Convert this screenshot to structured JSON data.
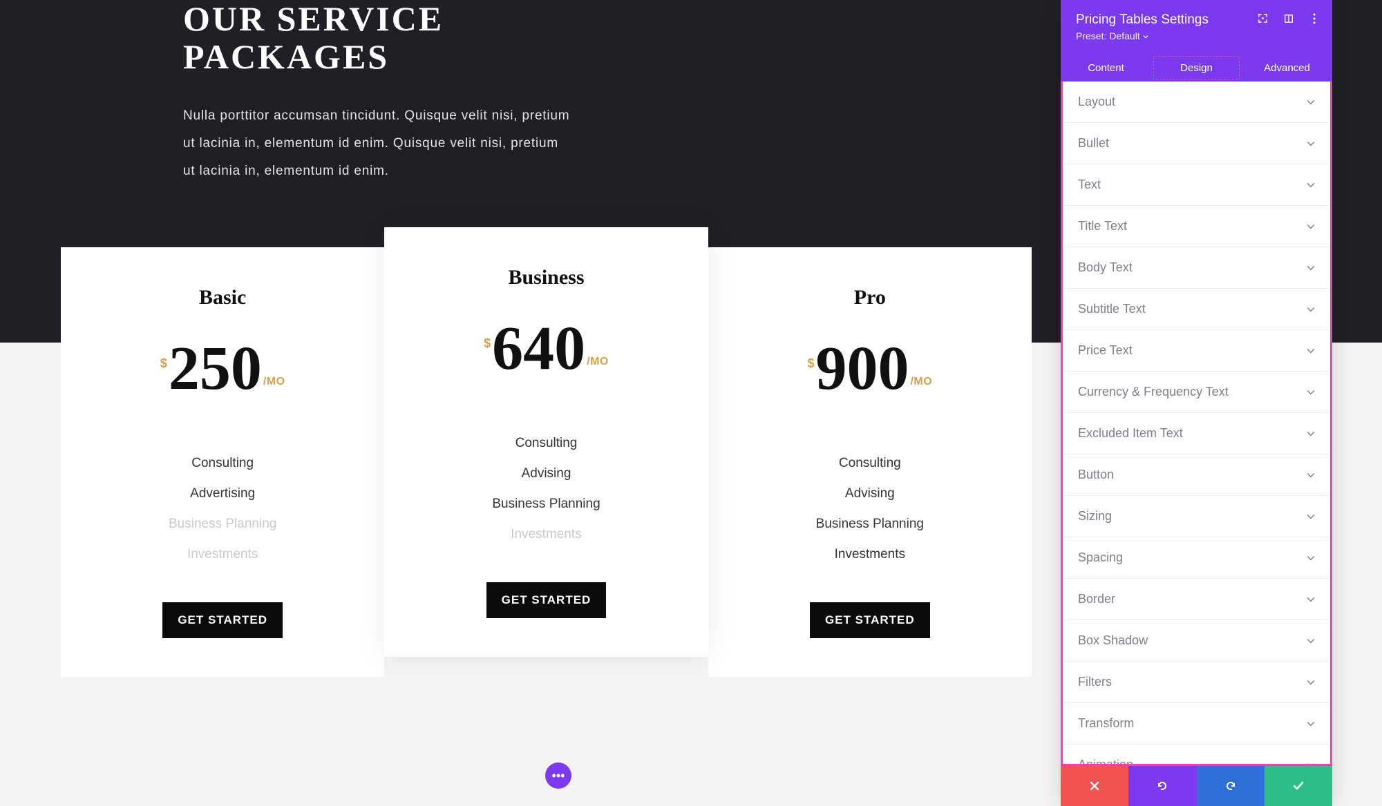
{
  "hero": {
    "title_line1": "OUR SERVICE",
    "title_line2": "PACKAGES",
    "body": "Nulla porttitor accumsan tincidunt. Quisque velit nisi, pretium ut lacinia in, elementum id enim. Quisque velit nisi, pretium ut lacinia in, elementum id enim."
  },
  "pricing": {
    "currency": "$",
    "frequency": "/MO",
    "cta_label": "GET STARTED",
    "tiers": [
      {
        "name": "Basic",
        "price": "250",
        "features": [
          {
            "label": "Consulting",
            "excluded": false
          },
          {
            "label": "Advertising",
            "excluded": false
          },
          {
            "label": "Business Planning",
            "excluded": true
          },
          {
            "label": "Investments",
            "excluded": true
          }
        ]
      },
      {
        "name": "Business",
        "price": "640",
        "featured": true,
        "features": [
          {
            "label": "Consulting",
            "excluded": false
          },
          {
            "label": "Advising",
            "excluded": false
          },
          {
            "label": "Business Planning",
            "excluded": false
          },
          {
            "label": "Investments",
            "excluded": true
          }
        ]
      },
      {
        "name": "Pro",
        "price": "900",
        "features": [
          {
            "label": "Consulting",
            "excluded": false
          },
          {
            "label": "Advising",
            "excluded": false
          },
          {
            "label": "Business Planning",
            "excluded": false
          },
          {
            "label": "Investments",
            "excluded": false
          }
        ]
      }
    ]
  },
  "panel": {
    "title": "Pricing Tables Settings",
    "preset_label": "Preset:",
    "preset_value": "Default",
    "tabs": {
      "content": "Content",
      "design": "Design",
      "advanced": "Advanced"
    },
    "active_tab": "design",
    "accordion": [
      "Layout",
      "Bullet",
      "Text",
      "Title Text",
      "Body Text",
      "Subtitle Text",
      "Price Text",
      "Currency & Frequency Text",
      "Excluded Item Text",
      "Button",
      "Sizing",
      "Spacing",
      "Border",
      "Box Shadow",
      "Filters",
      "Transform",
      "Animation"
    ]
  },
  "colors": {
    "hero_bg": "#1f1f24",
    "accent_gold": "#d6a14e",
    "primary_purple": "#7c3aed",
    "outline_pink": "#ff3db4",
    "footer_red": "#ef5350",
    "footer_blue": "#2f6fd8",
    "footer_green": "#2bbf8a"
  }
}
